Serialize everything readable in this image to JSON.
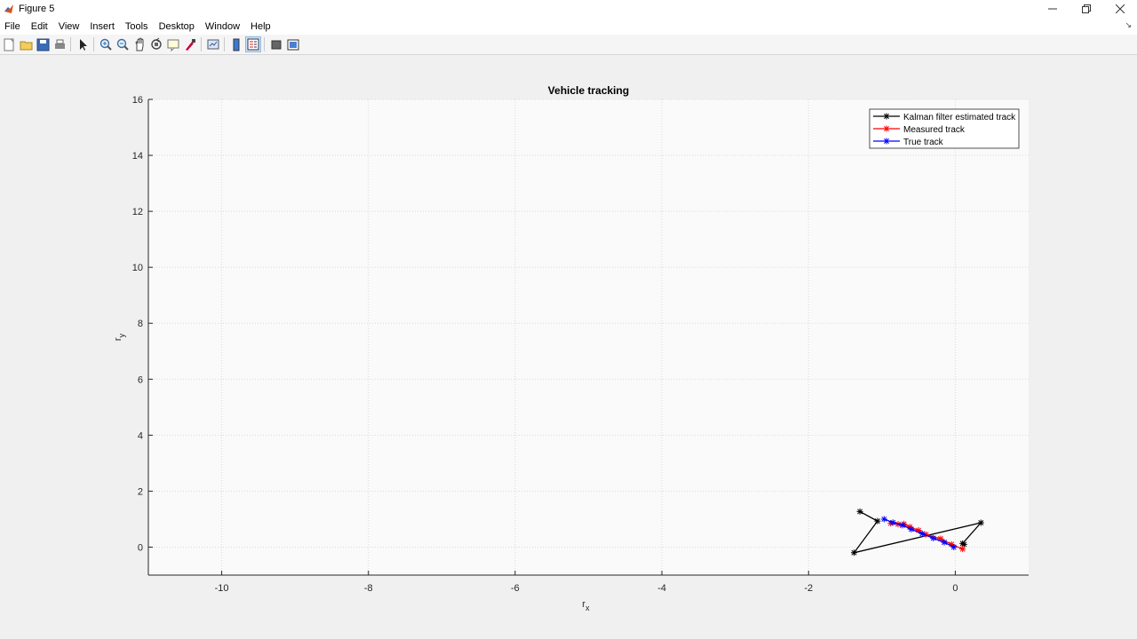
{
  "window": {
    "title": "Figure 5"
  },
  "menu": [
    "File",
    "Edit",
    "View",
    "Insert",
    "Tools",
    "Desktop",
    "Window",
    "Help"
  ],
  "toolbar": [
    {
      "name": "new-figure-icon"
    },
    {
      "name": "open-file-icon"
    },
    {
      "name": "save-icon"
    },
    {
      "name": "print-icon"
    },
    {
      "sep": true
    },
    {
      "name": "pointer-icon"
    },
    {
      "sep": true
    },
    {
      "name": "zoom-in-icon"
    },
    {
      "name": "zoom-out-icon"
    },
    {
      "name": "pan-icon"
    },
    {
      "name": "rotate-3d-icon"
    },
    {
      "name": "data-cursor-icon"
    },
    {
      "name": "brush-icon"
    },
    {
      "sep": true
    },
    {
      "name": "link-plot-icon"
    },
    {
      "sep": true
    },
    {
      "name": "colorbar-icon"
    },
    {
      "name": "legend-icon",
      "active": true
    },
    {
      "sep": true
    },
    {
      "name": "hide-plot-tools-icon"
    },
    {
      "name": "show-plot-tools-icon"
    }
  ],
  "colors": {
    "kalman": "#000000",
    "measured": "#ff0000",
    "true": "#0000ff",
    "grid": "#d9d9d9",
    "axes_bg": "#fafafa"
  },
  "chart_data": {
    "type": "line",
    "title": "Vehicle tracking",
    "xlabel": "r",
    "xlabel_sub": "x",
    "ylabel": "r",
    "ylabel_sub": "y",
    "xlim": [
      -11,
      1
    ],
    "ylim": [
      -1,
      16
    ],
    "xticks": [
      -10,
      -8,
      -6,
      -4,
      -2,
      0
    ],
    "yticks": [
      0,
      2,
      4,
      6,
      8,
      10,
      12,
      14,
      16
    ],
    "grid": true,
    "legend_position": "top-right",
    "series": [
      {
        "name": "Kalman filter estimated track",
        "color_key": "kalman",
        "x": [
          -1.3,
          -1.06,
          -1.38,
          0.35,
          0.1,
          0.12
        ],
        "y": [
          1.27,
          0.93,
          -0.2,
          0.87,
          0.13,
          0.1
        ]
      },
      {
        "name": "Measured track",
        "color_key": "measured",
        "x": [
          -0.88,
          -0.78,
          -0.7,
          -0.62,
          -0.5,
          -0.4,
          -0.2,
          -0.05,
          0.1
        ],
        "y": [
          0.85,
          0.82,
          0.83,
          0.72,
          0.6,
          0.45,
          0.3,
          0.1,
          -0.07
        ]
      },
      {
        "name": "True track",
        "color_key": "true",
        "x": [
          -0.97,
          -0.85,
          -0.72,
          -0.6,
          -0.45,
          -0.3,
          -0.15,
          -0.02
        ],
        "y": [
          1.0,
          0.88,
          0.78,
          0.64,
          0.48,
          0.32,
          0.17,
          0.0
        ]
      }
    ]
  }
}
